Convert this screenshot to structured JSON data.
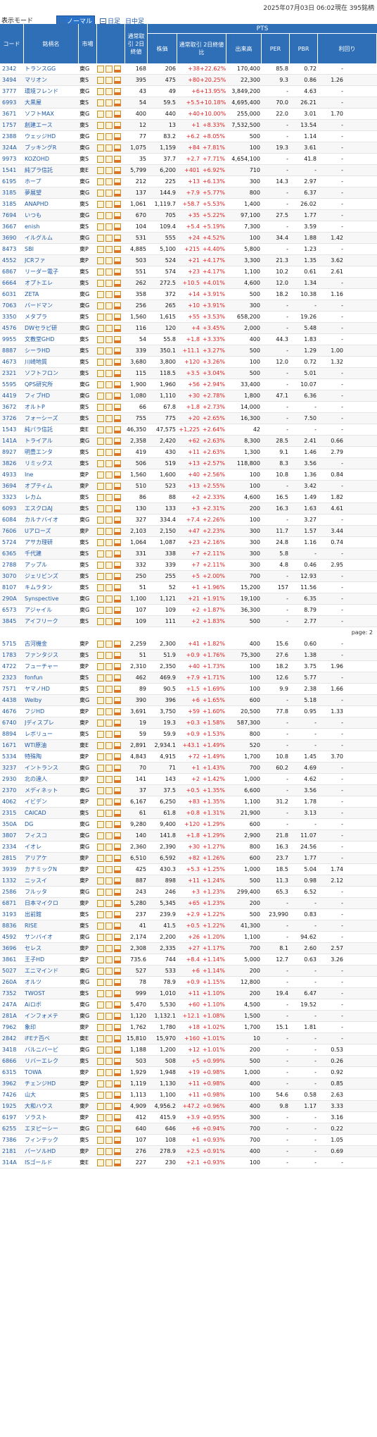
{
  "header": {
    "mode_label": "表示モード",
    "mode_normal": "ノーマル",
    "mode_day": "日足",
    "mode_day_mid": "日中足",
    "datetime": "2025年07月03日 06:02現在 395銘柄"
  },
  "table_headers": {
    "code": "コード",
    "name": "銘柄名",
    "market": "市場",
    "regular": "通常取引 2日終値",
    "pts": "PTS",
    "price": "株価",
    "compare": "通常取引 2日終値比",
    "volume": "出来高",
    "per": "PER",
    "pbr": "PBR",
    "yield": "利回り"
  },
  "page_label": "page: 2",
  "rows": [
    [
      "2342",
      "トランスGG",
      "東G",
      "168",
      "206",
      "+38",
      "+22.62%",
      "170,400",
      "85.8",
      "0.72",
      "-"
    ],
    [
      "3494",
      "マリオン",
      "東S",
      "395",
      "475",
      "+80",
      "+20.25%",
      "22,300",
      "9.3",
      "0.86",
      "1.26"
    ],
    [
      "3777",
      "環境フレンド",
      "東G",
      "43",
      "49",
      "+6",
      "+13.95%",
      "3,849,200",
      "-",
      "4.63",
      "-"
    ],
    [
      "6993",
      "大黒屋",
      "東S",
      "54",
      "59.5",
      "+5.5",
      "+10.18%",
      "4,695,400",
      "70.0",
      "26.21",
      "-"
    ],
    [
      "3671",
      "ソフトMAX",
      "東G",
      "400",
      "440",
      "+40",
      "+10.00%",
      "255,000",
      "22.0",
      "3.01",
      "1.70"
    ],
    [
      "1757",
      "創建エース",
      "東S",
      "12",
      "13",
      "+1",
      "+8.33%",
      "7,532,500",
      "-",
      "13.54",
      "-"
    ],
    [
      "2388",
      "ウェッジHD",
      "東G",
      "77",
      "83.2",
      "+6.2",
      "+8.05%",
      "500",
      "-",
      "1.14",
      "-"
    ],
    [
      "324A",
      "ブッキングR",
      "東G",
      "1,075",
      "1,159",
      "+84",
      "+7.81%",
      "100",
      "19.3",
      "3.61",
      "-"
    ],
    [
      "9973",
      "KOZOHD",
      "東S",
      "35",
      "37.7",
      "+2.7",
      "+7.71%",
      "4,654,100",
      "-",
      "41.8",
      "-"
    ],
    [
      "1541",
      "純プラ信託",
      "東E",
      "5,799",
      "6,200",
      "+401",
      "+6.92%",
      "710",
      "-",
      "-",
      "-"
    ],
    [
      "6195",
      "ホープ",
      "東G",
      "212",
      "225",
      "+13",
      "+6.13%",
      "300",
      "14.3",
      "2.97",
      "-"
    ],
    [
      "3185",
      "夢展望",
      "東G",
      "137",
      "144.9",
      "+7.9",
      "+5.77%",
      "800",
      "-",
      "6.37",
      "-"
    ],
    [
      "3185",
      "ANAPHD",
      "東S",
      "1,061",
      "1,119.7",
      "+58.7",
      "+5.53%",
      "1,400",
      "-",
      "26.02",
      "-"
    ],
    [
      "7694",
      "いつも",
      "東G",
      "670",
      "705",
      "+35",
      "+5.22%",
      "97,100",
      "27.5",
      "1.77",
      "-"
    ],
    [
      "3667",
      "enish",
      "東S",
      "104",
      "109.4",
      "+5.4",
      "+5.19%",
      "7,300",
      "-",
      "3.59",
      "-"
    ],
    [
      "3690",
      "イルグルム",
      "東G",
      "531",
      "555",
      "+24",
      "+4.52%",
      "100",
      "34.4",
      "1.88",
      "1.42"
    ],
    [
      "8473",
      "SBI",
      "東P",
      "4,885",
      "5,100",
      "+215",
      "+4.40%",
      "5,800",
      "-",
      "1.23",
      "-"
    ],
    [
      "4552",
      "JCRファ",
      "東P",
      "503",
      "524",
      "+21",
      "+4.17%",
      "3,300",
      "21.3",
      "1.35",
      "3.62"
    ],
    [
      "6867",
      "リーダー電子",
      "東S",
      "551",
      "574",
      "+23",
      "+4.17%",
      "1,100",
      "10.2",
      "0.61",
      "2.61"
    ],
    [
      "6664",
      "オプトエレ",
      "東S",
      "262",
      "272.5",
      "+10.5",
      "+4.01%",
      "4,600",
      "12.0",
      "1.34",
      "-"
    ],
    [
      "6031",
      "ZETA",
      "東G",
      "358",
      "372",
      "+14",
      "+3.91%",
      "500",
      "18.2",
      "10.38",
      "1.16"
    ],
    [
      "7063",
      "バードマン",
      "東G",
      "256",
      "265",
      "+10",
      "+3.91%",
      "300",
      "-",
      "-",
      "-"
    ],
    [
      "3350",
      "メタプラ",
      "東S",
      "1,560",
      "1,615",
      "+55",
      "+3.53%",
      "658,200",
      "-",
      "19.26",
      "-"
    ],
    [
      "4576",
      "DWセラピ研",
      "東G",
      "116",
      "120",
      "+4",
      "+3.45%",
      "2,000",
      "-",
      "5.48",
      "-"
    ],
    [
      "9955",
      "文教堂GHD",
      "東S",
      "54",
      "55.8",
      "+1.8",
      "+3.33%",
      "400",
      "44.3",
      "1.83",
      "-"
    ],
    [
      "8887",
      "シーラHD",
      "東S",
      "339",
      "350.1",
      "+11.1",
      "+3.27%",
      "500",
      "-",
      "1.29",
      "1.00"
    ],
    [
      "4673",
      "川崎地質",
      "東S",
      "3,680",
      "3,800",
      "+120",
      "+3.26%",
      "100",
      "12.0",
      "0.72",
      "1.32"
    ],
    [
      "2321",
      "ソフトフロン",
      "東S",
      "115",
      "118.5",
      "+3.5",
      "+3.04%",
      "500",
      "-",
      "5.01",
      "-"
    ],
    [
      "5595",
      "QPS研究所",
      "東G",
      "1,900",
      "1,960",
      "+56",
      "+2.94%",
      "33,400",
      "-",
      "10.07",
      "-"
    ],
    [
      "4419",
      "フィブHD",
      "東G",
      "1,080",
      "1,110",
      "+30",
      "+2.78%",
      "1,800",
      "47.1",
      "6.36",
      "-"
    ],
    [
      "3672",
      "オルトP",
      "東S",
      "66",
      "67.8",
      "+1.8",
      "+2.73%",
      "14,000",
      "-",
      "-",
      "-"
    ],
    [
      "3726",
      "フォーシーズ",
      "東S",
      "755",
      "775",
      "+20",
      "+2.65%",
      "16,300",
      "-",
      "7.50",
      "-"
    ],
    [
      "1543",
      "純パラ信託",
      "東E",
      "46,350",
      "47,575",
      "+1,225",
      "+2.64%",
      "42",
      "-",
      "-",
      "-"
    ],
    [
      "141A",
      "トライアル",
      "東G",
      "2,358",
      "2,420",
      "+62",
      "+2.63%",
      "8,300",
      "28.5",
      "2.41",
      "0.66"
    ],
    [
      "8927",
      "明豊エンタ",
      "東S",
      "419",
      "430",
      "+11",
      "+2.63%",
      "1,300",
      "9.1",
      "1.46",
      "2.79"
    ],
    [
      "3826",
      "リミックス",
      "東S",
      "506",
      "519",
      "+13",
      "+2.57%",
      "118,800",
      "8.3",
      "3.56",
      "-"
    ],
    [
      "4933",
      "Ine",
      "東P",
      "1,560",
      "1,600",
      "+40",
      "+2.56%",
      "100",
      "10.8",
      "1.36",
      "0.84"
    ],
    [
      "3694",
      "オプティム",
      "東P",
      "510",
      "523",
      "+13",
      "+2.55%",
      "100",
      "-",
      "3.42",
      "-"
    ],
    [
      "3323",
      "レカム",
      "東S",
      "86",
      "88",
      "+2",
      "+2.33%",
      "4,600",
      "16.5",
      "1.49",
      "1.82"
    ],
    [
      "6093",
      "エスクロAJ",
      "東S",
      "130",
      "133",
      "+3",
      "+2.31%",
      "200",
      "16.3",
      "1.63",
      "4.61"
    ],
    [
      "6084",
      "カルナバイオ",
      "東G",
      "327",
      "334.4",
      "+7.4",
      "+2.26%",
      "100",
      "-",
      "3.27",
      "-"
    ],
    [
      "7606",
      "Uアローズ",
      "東P",
      "2,103",
      "2,150",
      "+47",
      "+2.23%",
      "300",
      "11.7",
      "1.57",
      "3.44"
    ],
    [
      "5724",
      "アサカ理研",
      "東S",
      "1,064",
      "1,087",
      "+23",
      "+2.16%",
      "300",
      "24.8",
      "1.16",
      "0.74"
    ],
    [
      "6365",
      "千代建",
      "東S",
      "331",
      "338",
      "+7",
      "+2.11%",
      "300",
      "5.8",
      "-",
      "-"
    ],
    [
      "2788",
      "アップル",
      "東S",
      "332",
      "339",
      "+7",
      "+2.11%",
      "300",
      "4.8",
      "0.46",
      "2.95"
    ],
    [
      "3070",
      "ジェリビンズ",
      "東S",
      "250",
      "255",
      "+5",
      "+2.00%",
      "700",
      "-",
      "12.93",
      "-"
    ],
    [
      "8107",
      "キムラタン",
      "東S",
      "51",
      "52",
      "+1",
      "+1.96%",
      "15,200",
      "157",
      "11.56",
      "-"
    ],
    [
      "290A",
      "Synspective",
      "東G",
      "1,100",
      "1,121",
      "+21",
      "+1.91%",
      "19,100",
      "-",
      "6.35",
      "-"
    ],
    [
      "6573",
      "アジャイル",
      "東G",
      "107",
      "109",
      "+2",
      "+1.87%",
      "36,300",
      "-",
      "8.79",
      "-"
    ],
    [
      "3845",
      "アイフリーク",
      "東S",
      "109",
      "111",
      "+2",
      "+1.83%",
      "500",
      "-",
      "2.77",
      "-"
    ],
    [
      "5715",
      "古河機金",
      "東P",
      "2,259",
      "2,300",
      "+41",
      "+1.82%",
      "400",
      "15.6",
      "0.60",
      "-"
    ],
    [
      "1783",
      "ファンタジス",
      "東S",
      "51",
      "51.9",
      "+0.9",
      "+1.76%",
      "75,300",
      "27.6",
      "1.38",
      "-"
    ],
    [
      "4722",
      "フューチャー",
      "東P",
      "2,310",
      "2,350",
      "+40",
      "+1.73%",
      "100",
      "18.2",
      "3.75",
      "1.96"
    ],
    [
      "2323",
      "fonfun",
      "東S",
      "462",
      "469.9",
      "+7.9",
      "+1.71%",
      "100",
      "12.6",
      "5.77",
      "-"
    ],
    [
      "7571",
      "ヤマノHD",
      "東S",
      "89",
      "90.5",
      "+1.5",
      "+1.69%",
      "100",
      "9.9",
      "2.38",
      "1.66"
    ],
    [
      "4438",
      "Welby",
      "東G",
      "390",
      "396",
      "+6",
      "+1.65%",
      "600",
      "-",
      "5.18",
      "-"
    ],
    [
      "4676",
      "フジHD",
      "東P",
      "3,691",
      "3,750",
      "+59",
      "+1.60%",
      "20,500",
      "77.8",
      "0.95",
      "1.33"
    ],
    [
      "6740",
      "Jディスプレ",
      "東P",
      "19",
      "19.3",
      "+0.3",
      "+1.58%",
      "587,300",
      "-",
      "-",
      "-"
    ],
    [
      "8894",
      "レボリュー",
      "東S",
      "59",
      "59.9",
      "+0.9",
      "+1.53%",
      "800",
      "-",
      "-",
      "-"
    ],
    [
      "1671",
      "WTI原油",
      "東E",
      "2,891",
      "2,934.1",
      "+43.1",
      "+1.49%",
      "520",
      "-",
      "-",
      "-"
    ],
    [
      "5334",
      "特殊陶",
      "東P",
      "4,843",
      "4,915",
      "+72",
      "+1.49%",
      "1,700",
      "10.8",
      "1.45",
      "3.70"
    ],
    [
      "3237",
      "イントランス",
      "東G",
      "70",
      "71",
      "+1",
      "+1.43%",
      "700",
      "60.2",
      "4.69",
      "-"
    ],
    [
      "2930",
      "北の達人",
      "東P",
      "141",
      "143",
      "+2",
      "+1.42%",
      "1,000",
      "-",
      "4.62",
      "-"
    ],
    [
      "2370",
      "メディネット",
      "東G",
      "37",
      "37.5",
      "+0.5",
      "+1.35%",
      "6,600",
      "-",
      "3.56",
      "-"
    ],
    [
      "4062",
      "イビデン",
      "東P",
      "6,167",
      "6,250",
      "+83",
      "+1.35%",
      "1,100",
      "31.2",
      "1.78",
      "-"
    ],
    [
      "2315",
      "CAICAD",
      "東S",
      "61",
      "61.8",
      "+0.8",
      "+1.31%",
      "21,900",
      "-",
      "3.13",
      "-"
    ],
    [
      "350A",
      "DG",
      "東G",
      "9,280",
      "9,400",
      "+120",
      "+1.29%",
      "600",
      "-",
      "-",
      "-"
    ],
    [
      "3807",
      "フィスコ",
      "東G",
      "140",
      "141.8",
      "+1.8",
      "+1.29%",
      "2,900",
      "21.8",
      "11.07",
      "-"
    ],
    [
      "2334",
      "イオレ",
      "東G",
      "2,360",
      "2,390",
      "+30",
      "+1.27%",
      "800",
      "16.3",
      "24.56",
      "-"
    ],
    [
      "2815",
      "アリアケ",
      "東P",
      "6,510",
      "6,592",
      "+82",
      "+1.26%",
      "600",
      "23.7",
      "1.77",
      "-"
    ],
    [
      "3939",
      "カナミックN",
      "東P",
      "425",
      "430.3",
      "+5.3",
      "+1.25%",
      "1,000",
      "18.5",
      "5.04",
      "1.74"
    ],
    [
      "1332",
      "ニッスイ",
      "東P",
      "887",
      "898",
      "+11",
      "+1.24%",
      "500",
      "11.3",
      "0.98",
      "2.12"
    ],
    [
      "2586",
      "フルッタ",
      "東G",
      "243",
      "246",
      "+3",
      "+1.23%",
      "299,400",
      "65.3",
      "6.52",
      "-"
    ],
    [
      "6871",
      "日本マイクロ",
      "東P",
      "5,280",
      "5,345",
      "+65",
      "+1.23%",
      "200",
      "-",
      "-",
      "-"
    ],
    [
      "3193",
      "出前館",
      "東S",
      "237",
      "239.9",
      "+2.9",
      "+1.22%",
      "500",
      "23,990",
      "0.83",
      "-"
    ],
    [
      "8836",
      "RISE",
      "東S",
      "41",
      "41.5",
      "+0.5",
      "+1.22%",
      "41,300",
      "-",
      "-",
      "-"
    ],
    [
      "4592",
      "サンバイオ",
      "東G",
      "2,174",
      "2,200",
      "+26",
      "+1.20%",
      "1,100",
      "-",
      "94.62",
      "-"
    ],
    [
      "3696",
      "セレス",
      "東P",
      "2,308",
      "2,335",
      "+27",
      "+1.17%",
      "700",
      "8.1",
      "2.60",
      "2.57"
    ],
    [
      "3861",
      "王子HD",
      "東P",
      "735.6",
      "744",
      "+8.4",
      "+1.14%",
      "5,000",
      "12.7",
      "0.63",
      "3.26"
    ],
    [
      "5027",
      "エニマインド",
      "東G",
      "527",
      "533",
      "+6",
      "+1.14%",
      "200",
      "-",
      "-",
      "-"
    ],
    [
      "260A",
      "オルツ",
      "東G",
      "78",
      "78.9",
      "+0.9",
      "+1.15%",
      "12,800",
      "-",
      "-",
      "-"
    ],
    [
      "7352",
      "TWOST",
      "東S",
      "999",
      "1,010",
      "+11",
      "+1.10%",
      "200",
      "19.4",
      "6.47",
      "-"
    ],
    [
      "247A",
      "Aiロボ",
      "東G",
      "5,470",
      "5,530",
      "+60",
      "+1.10%",
      "4,500",
      "-",
      "19.52",
      "-"
    ],
    [
      "281A",
      "インフォメテ",
      "東G",
      "1,120",
      "1,132.1",
      "+12.1",
      "+1.08%",
      "1,500",
      "-",
      "-",
      "-"
    ],
    [
      "7962",
      "象印",
      "東P",
      "1,762",
      "1,780",
      "+18",
      "+1.02%",
      "1,700",
      "15.1",
      "1.81",
      "-"
    ],
    [
      "2842",
      "iFEナ百ベ",
      "東E",
      "15,810",
      "15,970",
      "+160",
      "+1.01%",
      "10",
      "-",
      "-",
      "-"
    ],
    [
      "3418",
      "バルニバービ",
      "東G",
      "1,188",
      "1,200",
      "+12",
      "+1.01%",
      "200",
      "-",
      "-",
      "0.53"
    ],
    [
      "6866",
      "リバーエレク",
      "東S",
      "503",
      "508",
      "+5",
      "+0.99%",
      "500",
      "-",
      "-",
      "0.26"
    ],
    [
      "6315",
      "TOWA",
      "東P",
      "1,929",
      "1,948",
      "+19",
      "+0.98%",
      "1,000",
      "-",
      "-",
      "0.92"
    ],
    [
      "3962",
      "チェンジHD",
      "東P",
      "1,119",
      "1,130",
      "+11",
      "+0.98%",
      "400",
      "-",
      "-",
      "0.85"
    ],
    [
      "7426",
      "山大",
      "東S",
      "1,113",
      "1,100",
      "+11",
      "+0.98%",
      "100",
      "54.6",
      "0.58",
      "2.63"
    ],
    [
      "1925",
      "大和ハウス",
      "東P",
      "4,909",
      "4,956.2",
      "+47.2",
      "+0.96%",
      "400",
      "9.8",
      "1.17",
      "3.33"
    ],
    [
      "6197",
      "ソラスト",
      "東P",
      "412",
      "415.9",
      "+3.9",
      "+0.95%",
      "300",
      "-",
      "-",
      "3.16"
    ],
    [
      "6255",
      "エヌピーシー",
      "東G",
      "640",
      "646",
      "+6",
      "+0.94%",
      "700",
      "-",
      "-",
      "0.22"
    ],
    [
      "7386",
      "フィンテック",
      "東S",
      "107",
      "108",
      "+1",
      "+0.93%",
      "700",
      "-",
      "-",
      "1.05"
    ],
    [
      "2181",
      "パーソルHD",
      "東P",
      "276",
      "278.9",
      "+2.5",
      "+0.91%",
      "400",
      "-",
      "-",
      "0.69"
    ],
    [
      "314A",
      "ISゴールド",
      "東E",
      "227",
      "230",
      "+2.1",
      "+0.93%",
      "100",
      "-",
      "-",
      "-"
    ]
  ]
}
